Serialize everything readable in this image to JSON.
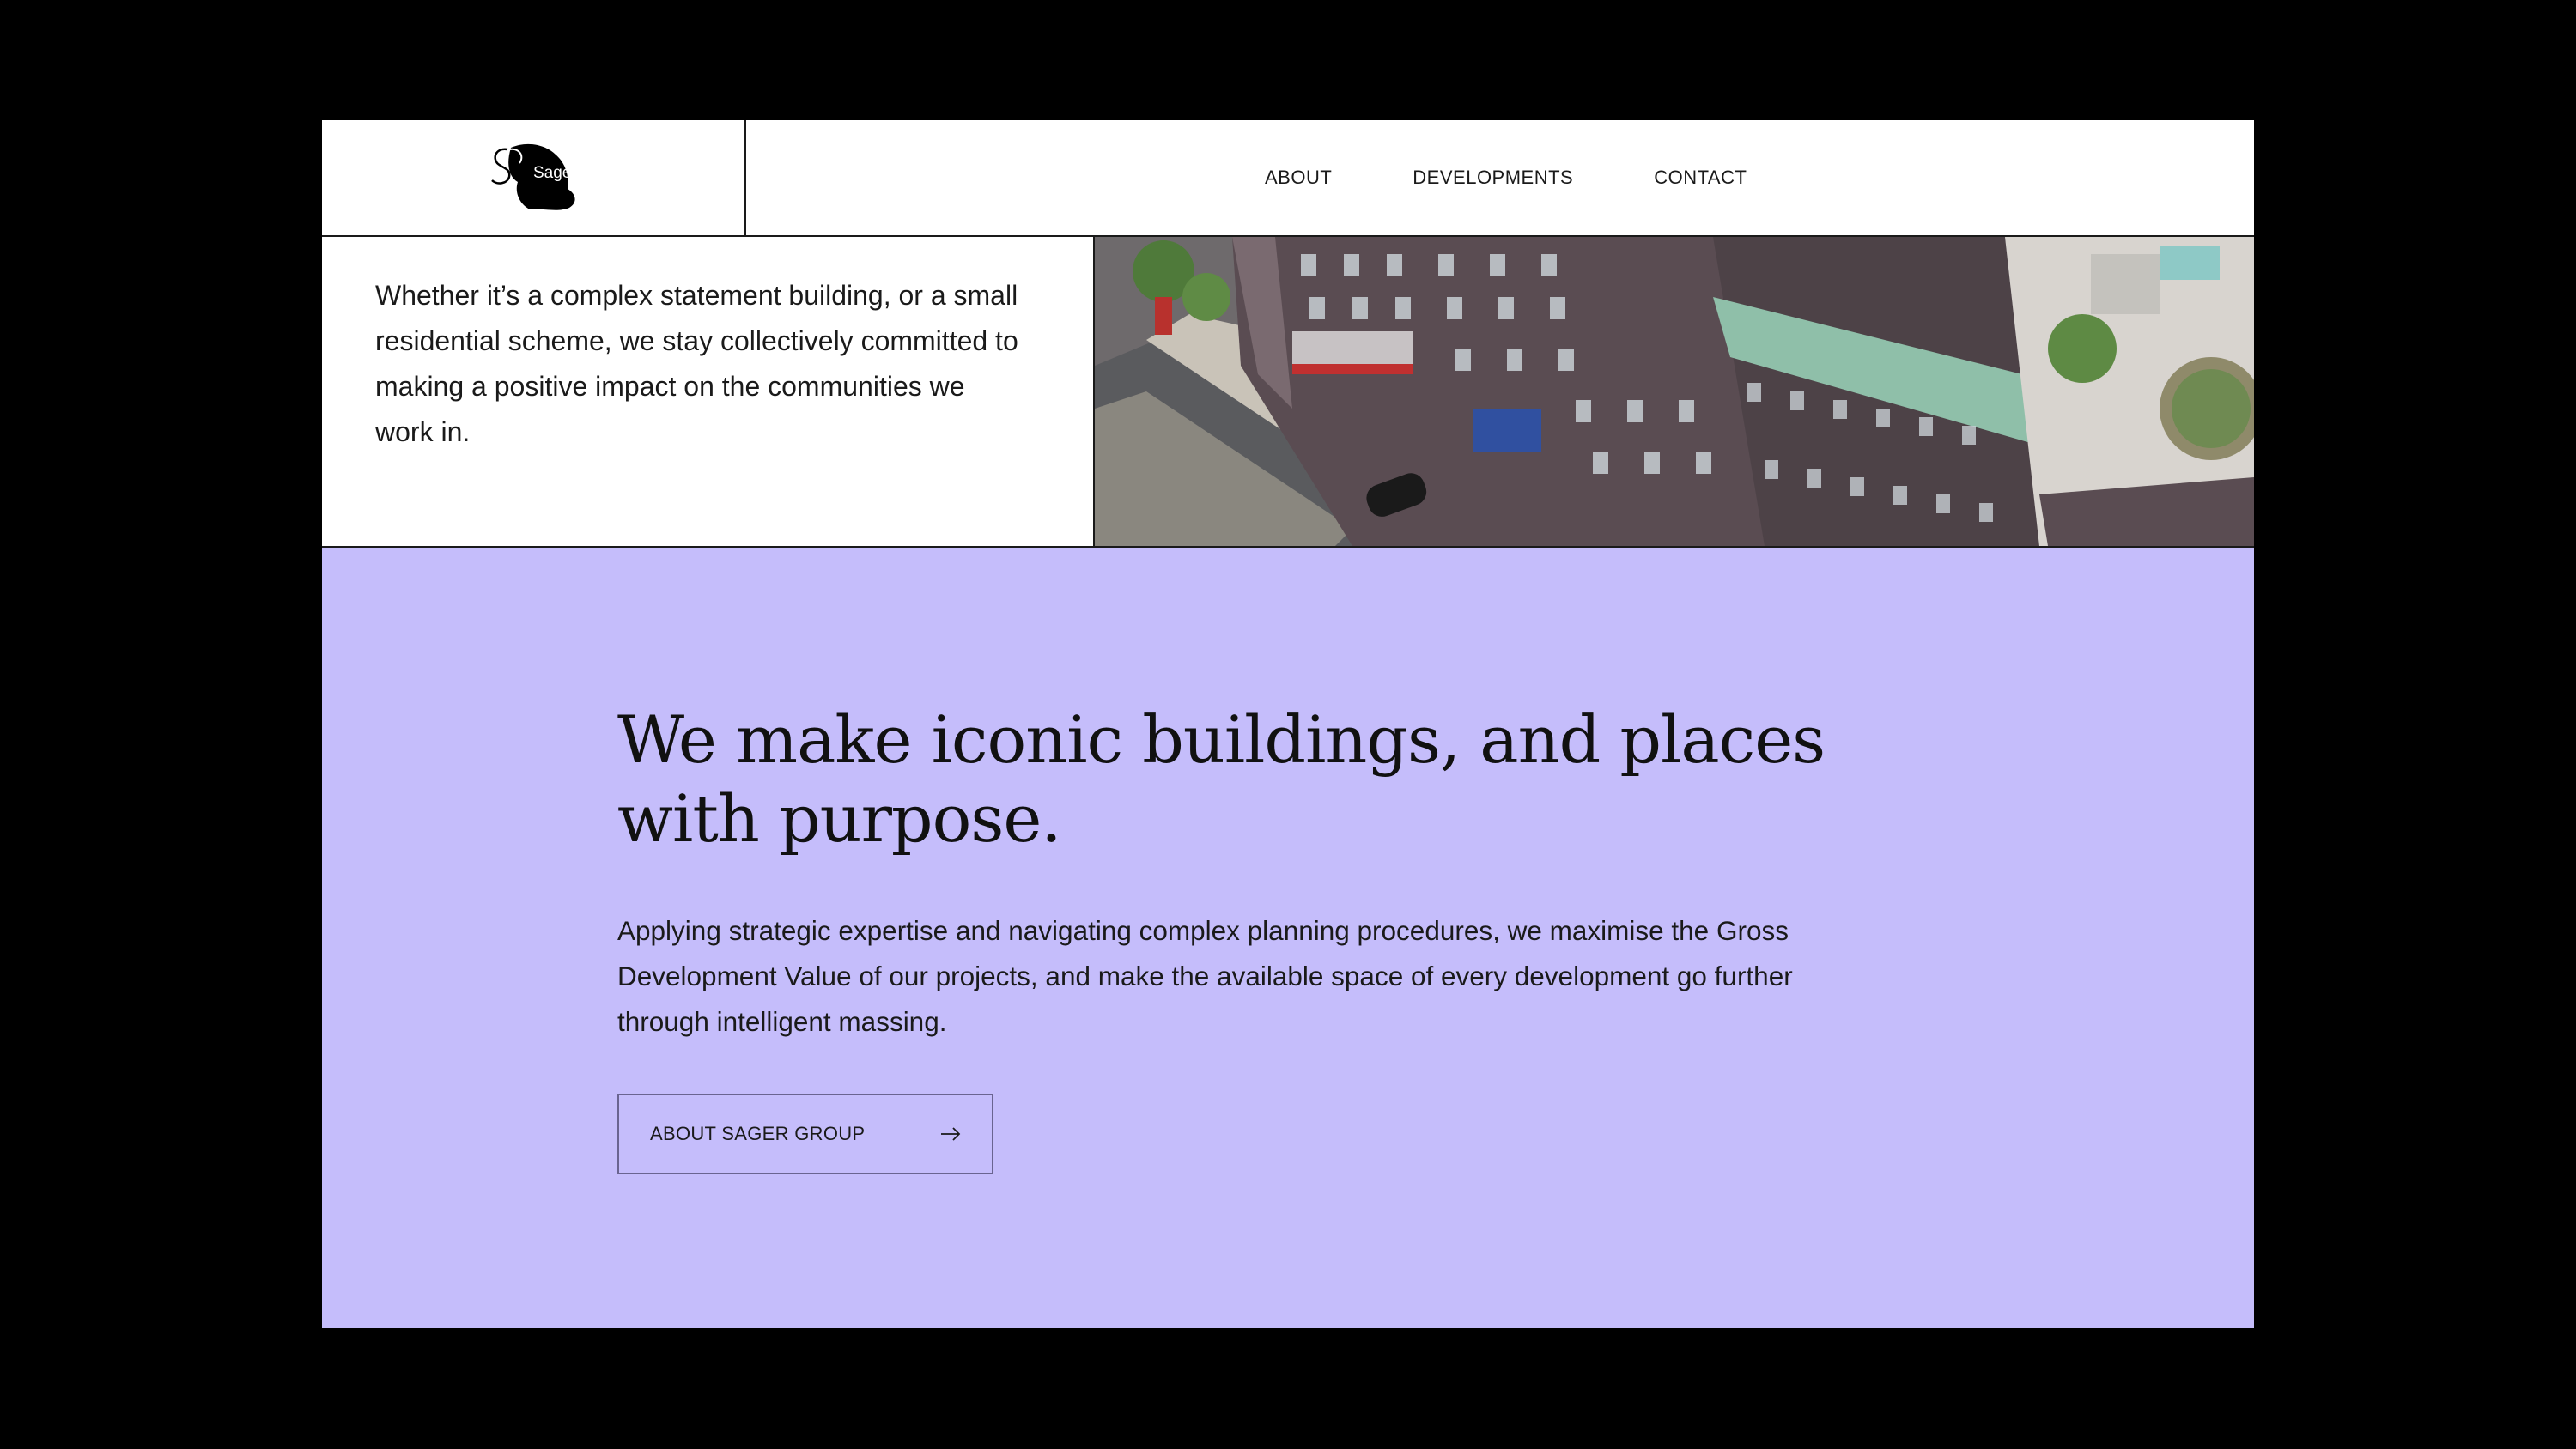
{
  "header": {
    "logo_text": "Sager",
    "nav": [
      {
        "label": "ABOUT"
      },
      {
        "label": "DEVELOPMENTS"
      },
      {
        "label": "CONTACT"
      }
    ]
  },
  "intro": {
    "text": "Whether it’s a complex statement building, or a small residential scheme, we stay collectively committed to making a positive impact on the communities we work in."
  },
  "purpose": {
    "headline": "We make iconic buildings, and places with purpose.",
    "body": "Applying strategic expertise and navigating complex planning procedures, we maximise the Gross Development Value of our projects, and make the available space of every development go further through intelligent massing.",
    "cta_label": "ABOUT SAGER GROUP",
    "cta_icon": "arrow-right-icon",
    "background_color": "#c5bdfb"
  }
}
